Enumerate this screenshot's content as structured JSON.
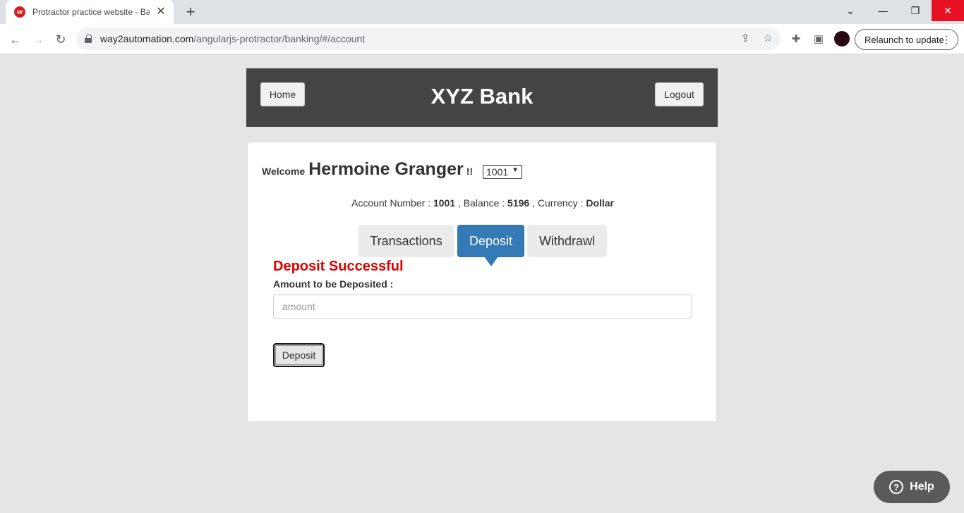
{
  "browser": {
    "tab_title": "Protractor practice website - Banking App",
    "url_host": "way2automation.com",
    "url_path": "/angularjs-protractor/banking/#/account",
    "relaunch_label": "Relaunch to update"
  },
  "header": {
    "home_label": "Home",
    "title": "XYZ Bank",
    "logout_label": "Logout"
  },
  "account": {
    "welcome_label": "Welcome",
    "customer_name": "Hermoine Granger",
    "welcome_suffix": "!!",
    "selected_account": "1001",
    "account_number_label": "Account Number :",
    "account_number": "1001",
    "balance_label": ", Balance :",
    "balance": "5196",
    "currency_label": ", Currency :",
    "currency": "Dollar"
  },
  "tabs": {
    "transactions": "Transactions",
    "deposit": "Deposit",
    "withdraw": "Withdrawl"
  },
  "deposit_form": {
    "message": "Deposit Successful",
    "amount_label": "Amount to be Deposited :",
    "amount_value": "",
    "amount_placeholder": "amount",
    "submit_label": "Deposit"
  },
  "help": {
    "label": "Help"
  },
  "colors": {
    "header_bg": "#444444",
    "active_tab": "#337ab7",
    "success_text": "#e00000"
  }
}
